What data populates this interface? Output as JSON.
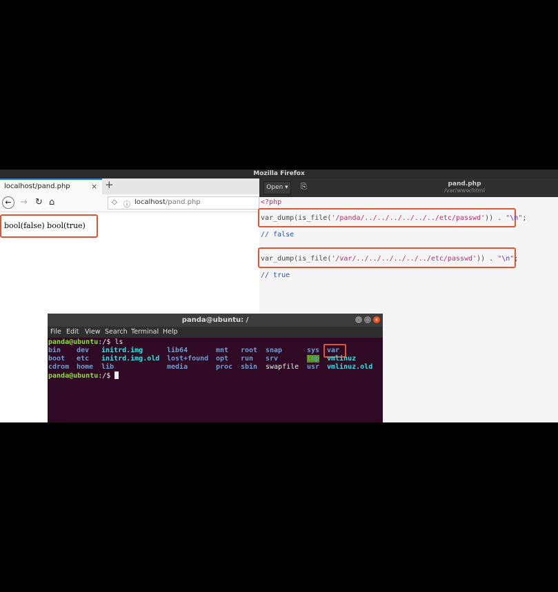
{
  "window_title": "Mozilla Firefox",
  "firefox": {
    "tab_label": "localhost/pand.php",
    "tab_close": "×",
    "new_tab": "+",
    "url_host": "localhost",
    "url_path": "/pand.php",
    "page_output": "bool(false) bool(true)"
  },
  "editor": {
    "open_label": "Open ▾",
    "title": "pand.php",
    "subtitle": "/var/www/html",
    "code_open_tag": "<?php",
    "line1": {
      "fn": "var_dump(is_file(",
      "str": "'/panda/../../../../../../etc/passwd'",
      "mid": ")) . ",
      "q1": "\"",
      "esc": "\\n",
      "q2": "\"",
      "end": ";"
    },
    "comment1": "// false",
    "line2": {
      "fn": "var_dump(is_file(",
      "str": "'/var/../../../../../../etc/passwd'",
      "mid": ")) . ",
      "q1": "\"",
      "esc": "\\n",
      "q2": "\"",
      "end": ";"
    },
    "comment2": "// true"
  },
  "terminal": {
    "title": "panda@ubuntu: /",
    "menu": [
      "File",
      "Edit",
      "View",
      "Search",
      "Terminal",
      "Help"
    ],
    "prompt": "panda@ubuntu",
    "prompt_path": ":/$ ",
    "command": "ls",
    "rows": [
      [
        "bin",
        "dev",
        "initrd.img",
        "lib64",
        "mnt",
        "root",
        "snap",
        "sys",
        "var"
      ],
      [
        "boot",
        "etc",
        "initrd.img.old",
        "lost+found",
        "opt",
        "run",
        "srv",
        "tmp",
        "vmlinuz"
      ],
      [
        "cdrom",
        "home",
        "lib",
        "media",
        "proc",
        "sbin",
        "swapfile",
        "usr",
        "vmlinuz.old"
      ]
    ]
  },
  "colors": {
    "highlight_box": "#e2542f",
    "terminal_bg": "#300a24",
    "prompt": "#8ae234",
    "directory": "#729fcf"
  }
}
